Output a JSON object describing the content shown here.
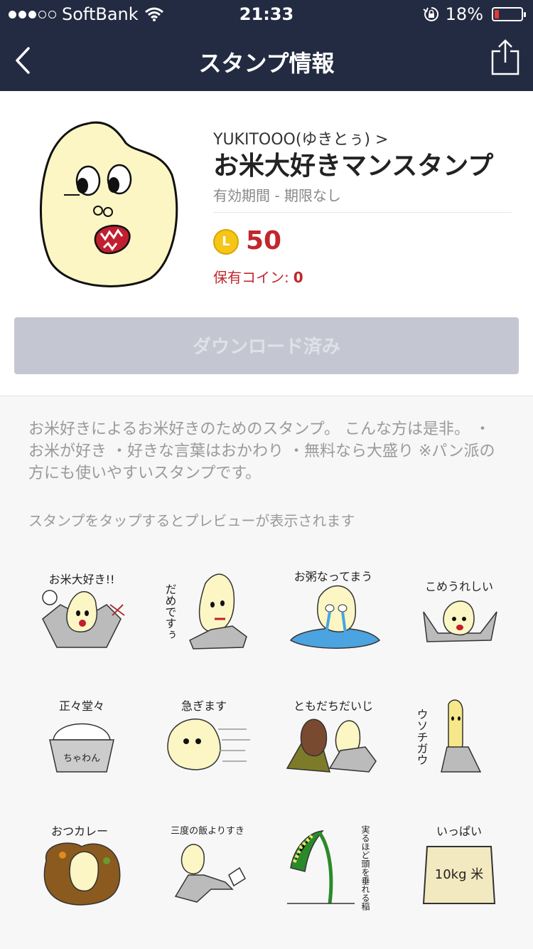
{
  "status_bar": {
    "carrier": "SoftBank",
    "time": "21:33",
    "battery_percent": "18%",
    "battery_level": 0.18
  },
  "nav": {
    "title": "スタンプ情報"
  },
  "sticker": {
    "author": "YUKITOOO(ゆきとぅ) >",
    "title": "お米大好きマンスタンプ",
    "validity": "有効期間 - 期限なし",
    "price": "50",
    "coin_letter": "L",
    "owned_label": "保有コイン:",
    "owned_value": "0",
    "download_button": "ダウンロード済み"
  },
  "description": "お米好きによるお米好きのためのスタンプ。 こんな方は是非。 ・お米が好き ・好きな言葉はおかわり ・無料なら大盛り ※パン派の方にも使いやすいスタンプです。",
  "preview_hint": "スタンプをタップするとプレビューが表示されます",
  "stickers": [
    {
      "caption": "お米大好き!!"
    },
    {
      "caption": "だめですぅ"
    },
    {
      "caption": "お粥なってまう"
    },
    {
      "caption": "こめうれしい"
    },
    {
      "caption": "正々堂々",
      "extra": "ちゃわん"
    },
    {
      "caption": "急ぎます"
    },
    {
      "caption": "ともだちだいじ"
    },
    {
      "caption": "ウソチガウ"
    },
    {
      "caption": "おつカレー"
    },
    {
      "caption": "三度の飯よりすき"
    },
    {
      "caption": "実るほど頭を垂れる稲穂かな"
    },
    {
      "caption": "いっぱい",
      "extra": "10kg 米"
    }
  ],
  "colors": {
    "nav_bg": "#232b42",
    "price_red": "#c1272d",
    "button_disabled": "#c4c7d2",
    "rice_fill": "#fbf6c4"
  }
}
